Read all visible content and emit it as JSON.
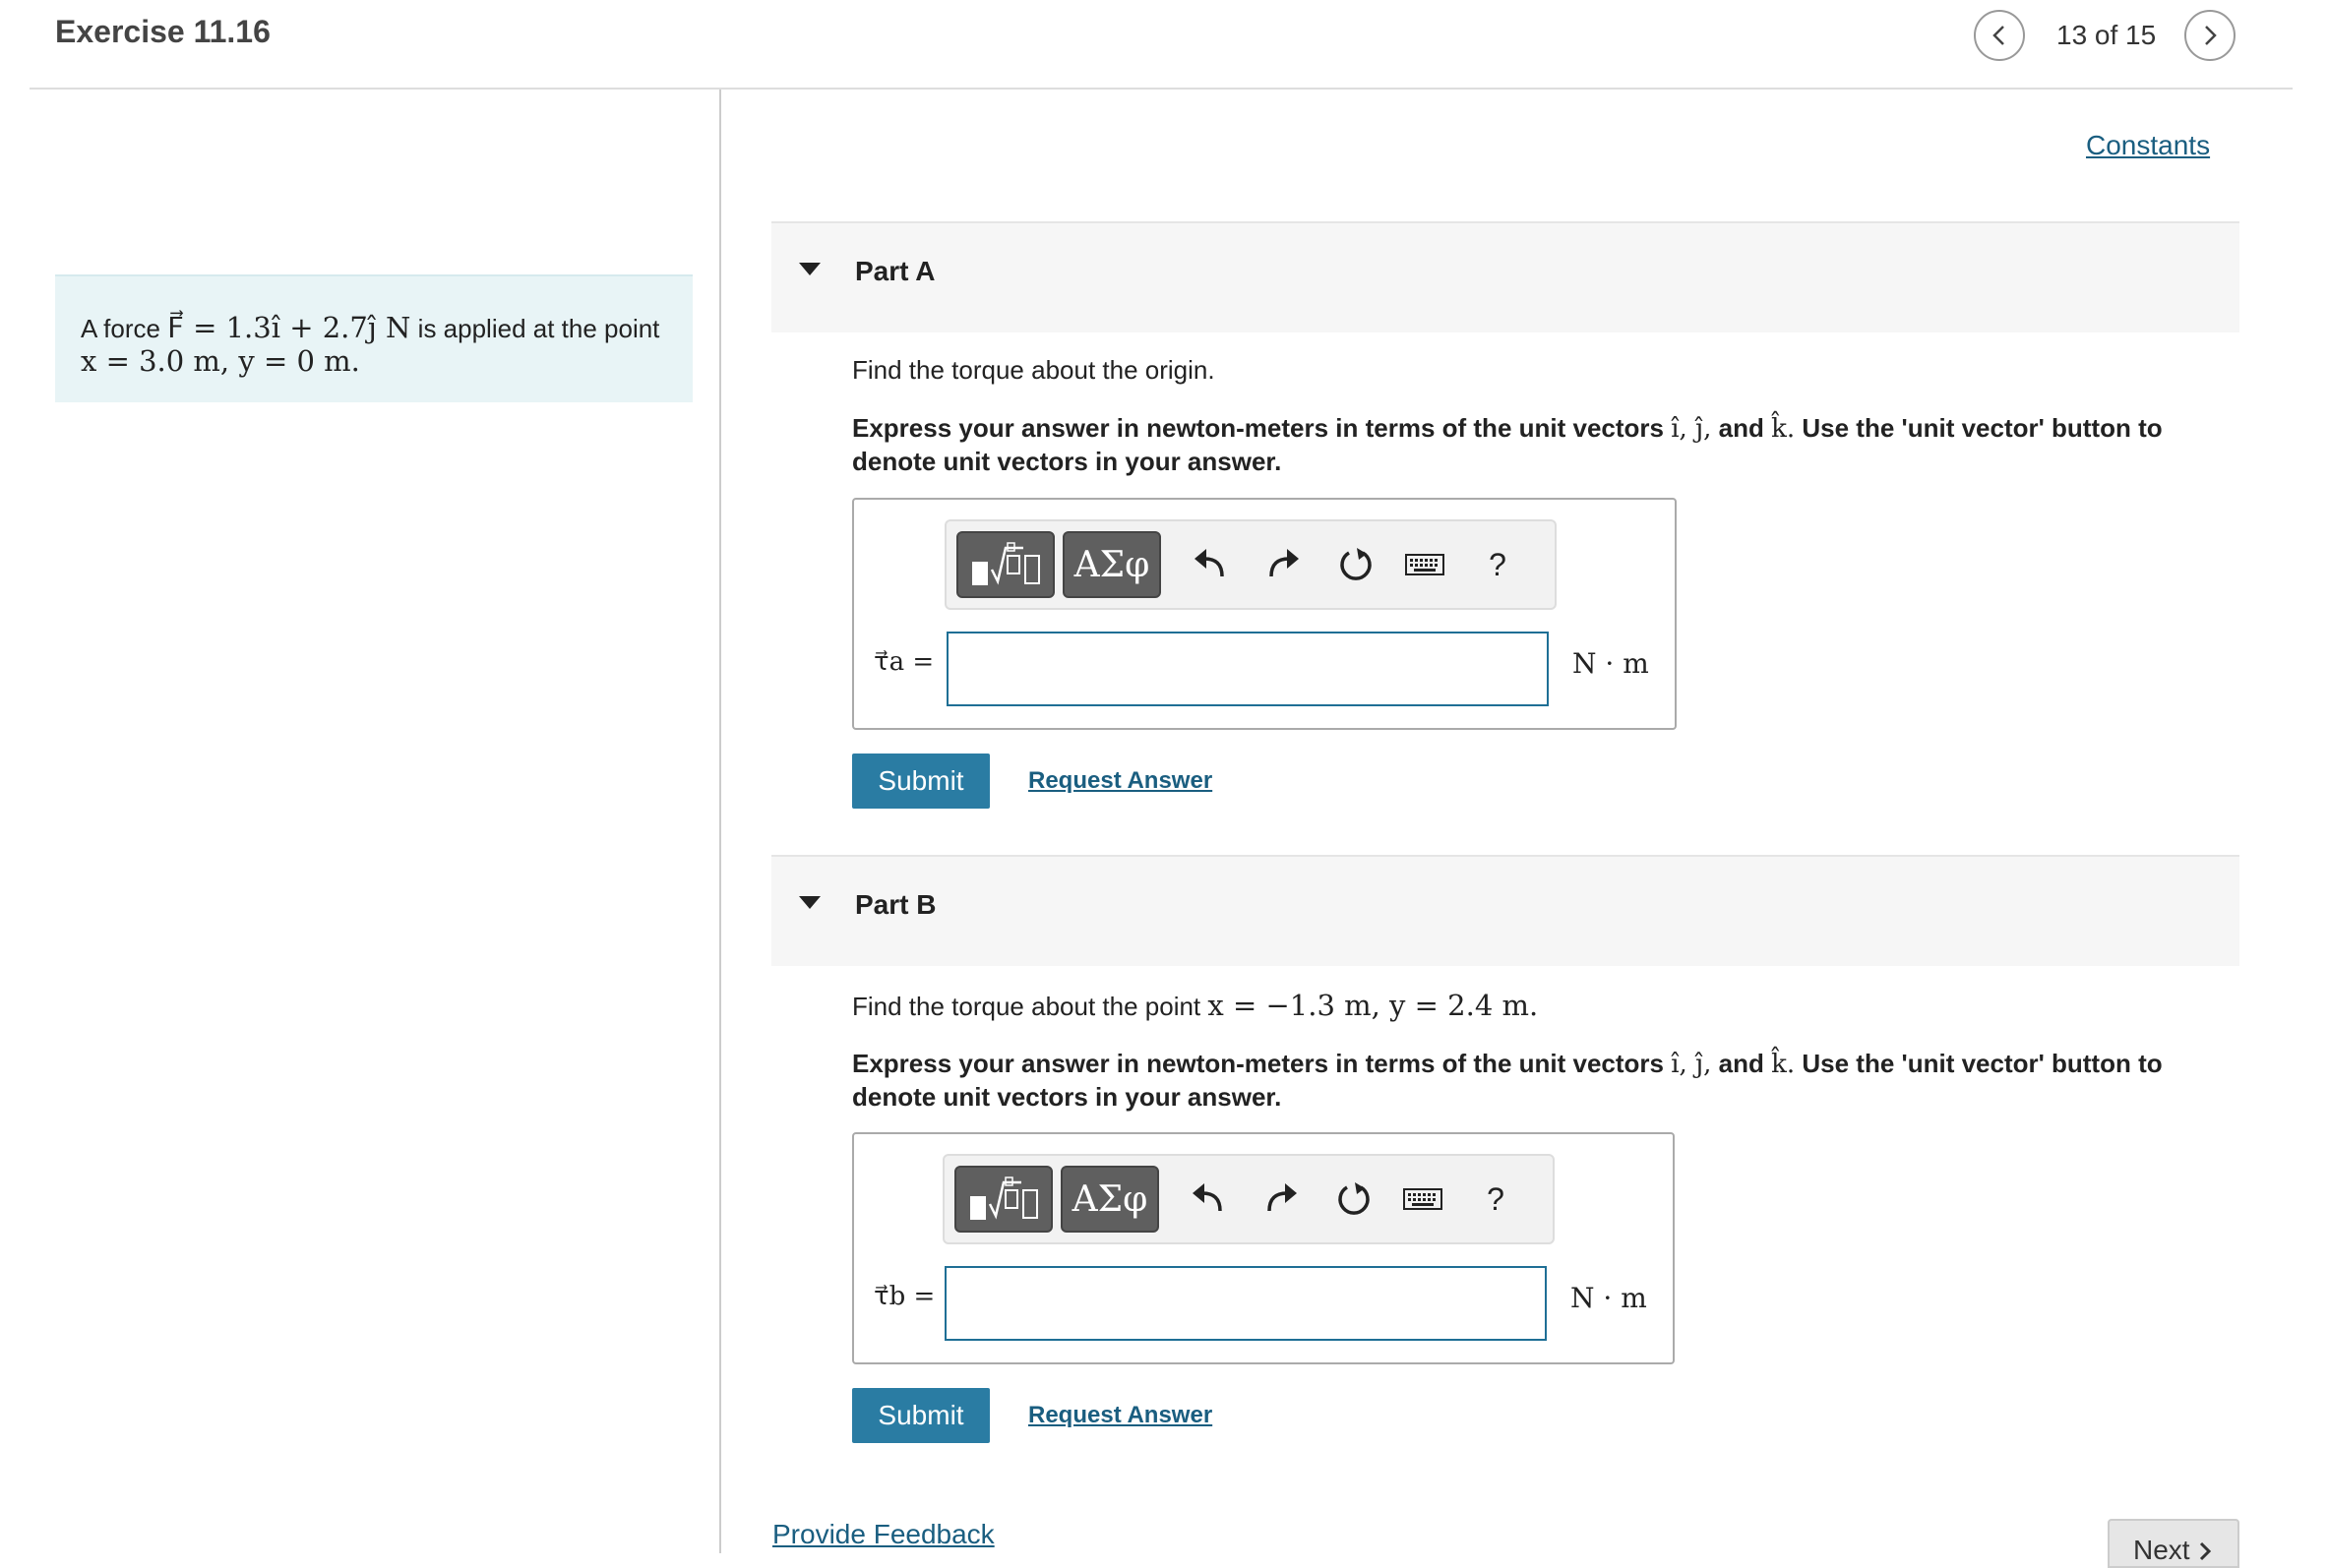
{
  "header": {
    "title": "Exercise 11.16",
    "pager": "13 of 15",
    "prev_icon": "chevron-left-icon",
    "next_icon": "chevron-right-icon"
  },
  "problem": {
    "prefix": "A force",
    "force_expr": "F⃗ = 1.3î + 2.7ĵ N",
    "suffix": "is applied at the point",
    "point": "x = 3.0 m, y = 0 m."
  },
  "constants_link": "Constants",
  "part_a": {
    "label": "Part A",
    "prompt": "Find the torque about the origin.",
    "instr_1": "Express your answer in newton-meters in terms of the unit vectors",
    "unit_vectors": "î, ĵ,",
    "instr_and": "and",
    "k_hat": "k̂.",
    "instr_2": "Use the 'unit vector' button to denote unit vectors in your answer.",
    "answer_label": "τ⃗a =",
    "answer_value": "",
    "unit": "N · m",
    "submit": "Submit",
    "request": "Request Answer"
  },
  "part_b": {
    "label": "Part B",
    "prompt_prefix": "Find the torque about the point",
    "prompt_point": "x = −1.3 m, y = 2.4 m.",
    "instr_1": "Express your answer in newton-meters in terms of the unit vectors",
    "unit_vectors": "î, ĵ,",
    "instr_and": "and",
    "k_hat": "k̂.",
    "instr_2": "Use the 'unit vector' button to denote unit vectors in your answer.",
    "answer_label": "τ⃗b =",
    "answer_value": "",
    "unit": "N · m",
    "submit": "Submit",
    "request": "Request Answer"
  },
  "toolbar": {
    "greek": "ΑΣφ",
    "help": "?"
  },
  "footer": {
    "feedback": "Provide Feedback",
    "next": "Next"
  },
  "colors": {
    "accent": "#2a7ca3",
    "link": "#1a5e80",
    "problem_bg": "#e8f4f6"
  }
}
